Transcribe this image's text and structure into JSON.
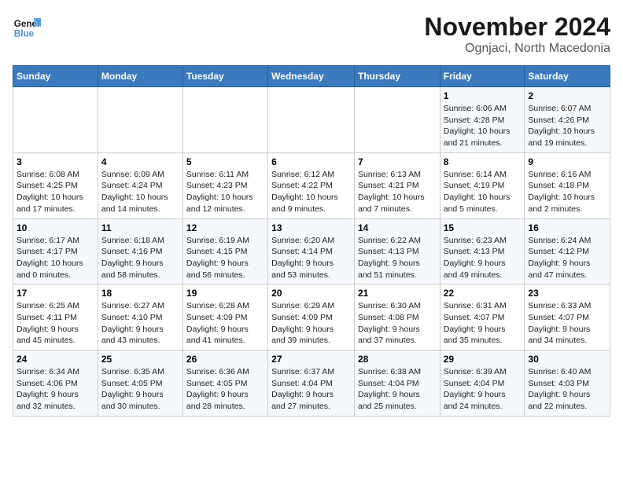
{
  "logo": {
    "line1": "General",
    "line2": "Blue"
  },
  "title": "November 2024",
  "location": "Ognjaci, North Macedonia",
  "weekdays": [
    "Sunday",
    "Monday",
    "Tuesday",
    "Wednesday",
    "Thursday",
    "Friday",
    "Saturday"
  ],
  "weeks": [
    [
      {
        "day": "",
        "info": ""
      },
      {
        "day": "",
        "info": ""
      },
      {
        "day": "",
        "info": ""
      },
      {
        "day": "",
        "info": ""
      },
      {
        "day": "",
        "info": ""
      },
      {
        "day": "1",
        "info": "Sunrise: 6:06 AM\nSunset: 4:28 PM\nDaylight: 10 hours\nand 21 minutes."
      },
      {
        "day": "2",
        "info": "Sunrise: 6:07 AM\nSunset: 4:26 PM\nDaylight: 10 hours\nand 19 minutes."
      }
    ],
    [
      {
        "day": "3",
        "info": "Sunrise: 6:08 AM\nSunset: 4:25 PM\nDaylight: 10 hours\nand 17 minutes."
      },
      {
        "day": "4",
        "info": "Sunrise: 6:09 AM\nSunset: 4:24 PM\nDaylight: 10 hours\nand 14 minutes."
      },
      {
        "day": "5",
        "info": "Sunrise: 6:11 AM\nSunset: 4:23 PM\nDaylight: 10 hours\nand 12 minutes."
      },
      {
        "day": "6",
        "info": "Sunrise: 6:12 AM\nSunset: 4:22 PM\nDaylight: 10 hours\nand 9 minutes."
      },
      {
        "day": "7",
        "info": "Sunrise: 6:13 AM\nSunset: 4:21 PM\nDaylight: 10 hours\nand 7 minutes."
      },
      {
        "day": "8",
        "info": "Sunrise: 6:14 AM\nSunset: 4:19 PM\nDaylight: 10 hours\nand 5 minutes."
      },
      {
        "day": "9",
        "info": "Sunrise: 6:16 AM\nSunset: 4:18 PM\nDaylight: 10 hours\nand 2 minutes."
      }
    ],
    [
      {
        "day": "10",
        "info": "Sunrise: 6:17 AM\nSunset: 4:17 PM\nDaylight: 10 hours\nand 0 minutes."
      },
      {
        "day": "11",
        "info": "Sunrise: 6:18 AM\nSunset: 4:16 PM\nDaylight: 9 hours\nand 58 minutes."
      },
      {
        "day": "12",
        "info": "Sunrise: 6:19 AM\nSunset: 4:15 PM\nDaylight: 9 hours\nand 56 minutes."
      },
      {
        "day": "13",
        "info": "Sunrise: 6:20 AM\nSunset: 4:14 PM\nDaylight: 9 hours\nand 53 minutes."
      },
      {
        "day": "14",
        "info": "Sunrise: 6:22 AM\nSunset: 4:13 PM\nDaylight: 9 hours\nand 51 minutes."
      },
      {
        "day": "15",
        "info": "Sunrise: 6:23 AM\nSunset: 4:13 PM\nDaylight: 9 hours\nand 49 minutes."
      },
      {
        "day": "16",
        "info": "Sunrise: 6:24 AM\nSunset: 4:12 PM\nDaylight: 9 hours\nand 47 minutes."
      }
    ],
    [
      {
        "day": "17",
        "info": "Sunrise: 6:25 AM\nSunset: 4:11 PM\nDaylight: 9 hours\nand 45 minutes."
      },
      {
        "day": "18",
        "info": "Sunrise: 6:27 AM\nSunset: 4:10 PM\nDaylight: 9 hours\nand 43 minutes."
      },
      {
        "day": "19",
        "info": "Sunrise: 6:28 AM\nSunset: 4:09 PM\nDaylight: 9 hours\nand 41 minutes."
      },
      {
        "day": "20",
        "info": "Sunrise: 6:29 AM\nSunset: 4:09 PM\nDaylight: 9 hours\nand 39 minutes."
      },
      {
        "day": "21",
        "info": "Sunrise: 6:30 AM\nSunset: 4:08 PM\nDaylight: 9 hours\nand 37 minutes."
      },
      {
        "day": "22",
        "info": "Sunrise: 6:31 AM\nSunset: 4:07 PM\nDaylight: 9 hours\nand 35 minutes."
      },
      {
        "day": "23",
        "info": "Sunrise: 6:33 AM\nSunset: 4:07 PM\nDaylight: 9 hours\nand 34 minutes."
      }
    ],
    [
      {
        "day": "24",
        "info": "Sunrise: 6:34 AM\nSunset: 4:06 PM\nDaylight: 9 hours\nand 32 minutes."
      },
      {
        "day": "25",
        "info": "Sunrise: 6:35 AM\nSunset: 4:05 PM\nDaylight: 9 hours\nand 30 minutes."
      },
      {
        "day": "26",
        "info": "Sunrise: 6:36 AM\nSunset: 4:05 PM\nDaylight: 9 hours\nand 28 minutes."
      },
      {
        "day": "27",
        "info": "Sunrise: 6:37 AM\nSunset: 4:04 PM\nDaylight: 9 hours\nand 27 minutes."
      },
      {
        "day": "28",
        "info": "Sunrise: 6:38 AM\nSunset: 4:04 PM\nDaylight: 9 hours\nand 25 minutes."
      },
      {
        "day": "29",
        "info": "Sunrise: 6:39 AM\nSunset: 4:04 PM\nDaylight: 9 hours\nand 24 minutes."
      },
      {
        "day": "30",
        "info": "Sunrise: 6:40 AM\nSunset: 4:03 PM\nDaylight: 9 hours\nand 22 minutes."
      }
    ]
  ]
}
